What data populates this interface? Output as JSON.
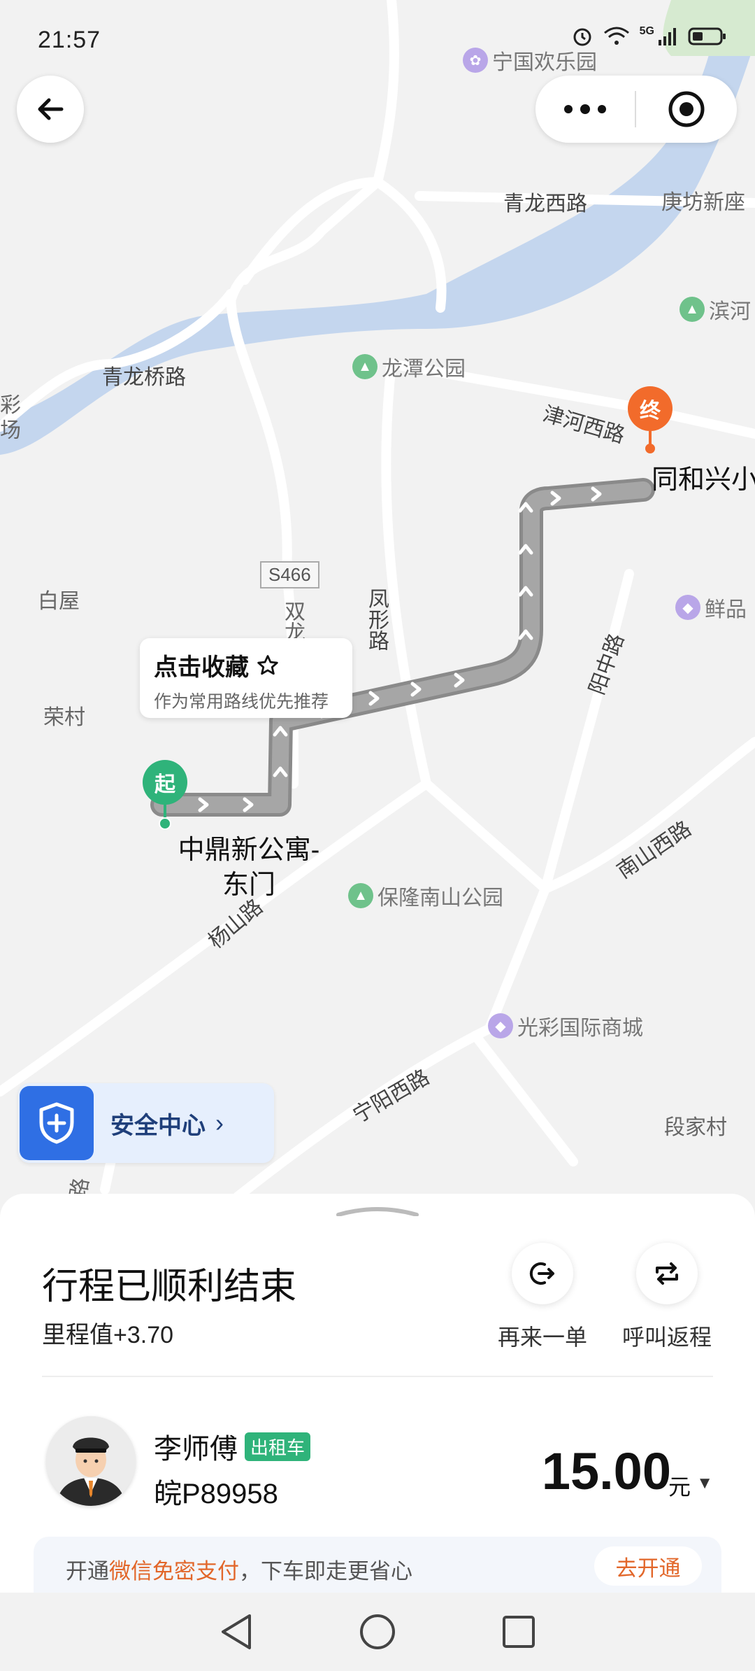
{
  "status_bar": {
    "time": "21:57",
    "network": "5G"
  },
  "top": {
    "back_label": "返回",
    "more_label": "更多",
    "locate_label": "定位"
  },
  "map": {
    "labels": {
      "ningguo_park": "宁国欢乐园",
      "qinglong_west": "青龙西路",
      "gengfang": "庚坊新座",
      "binhe": "滨河",
      "longtan_park": "龙潭公园",
      "qinglong_bridge": "青龙桥路",
      "jinhe_west": "津河西路",
      "tonghexing": "同和兴小",
      "s466": "S466",
      "shuanglong": "双龙",
      "fengxing": "凤形路",
      "baiwu": "白屋",
      "rongcun": "荣村",
      "xianpin": "鲜品",
      "yangzhong": "阳中路",
      "start_place": "中鼎新公寓-东门",
      "baolong_park": "保隆南山公园",
      "nanshan_west": "南山西路",
      "yangshan": "杨山路",
      "guangcai": "光彩国际商城",
      "ningyang_west": "宁阳西路",
      "duanjia": "段家村",
      "left_edge_1": "彩",
      "left_edge_2": "场",
      "bottom_road": "路"
    },
    "start_marker": "起",
    "end_marker": "终"
  },
  "favorite_tip": {
    "title": "点击收藏",
    "subtitle": "作为常用路线优先推荐"
  },
  "safety": {
    "label": "安全中心"
  },
  "trip": {
    "title": "行程已顺利结束",
    "mileage": "里程值+3.70",
    "actions": [
      {
        "label": "再来一单"
      },
      {
        "label": "呼叫返程"
      }
    ]
  },
  "driver": {
    "name": "李师傅",
    "badge": "出租车",
    "plate": "皖P89958"
  },
  "fare": {
    "amount": "15.00",
    "unit": "元"
  },
  "pay": {
    "prefix": "开通",
    "highlight": "微信免密支付",
    "suffix": "，下车即走更省心",
    "button": "去开通"
  },
  "colors": {
    "accent_green": "#2fb37a",
    "end_orange": "#f26b2b",
    "safety_blue": "#2f6fe4",
    "water": "#c4d6ee"
  }
}
